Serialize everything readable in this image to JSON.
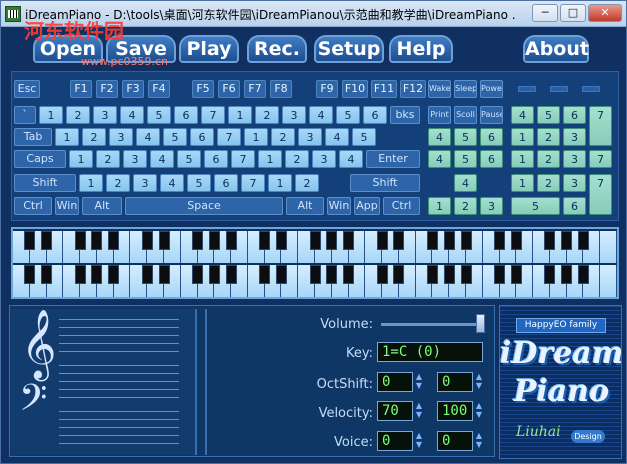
{
  "window": {
    "title": "iDreamPiano - D:\\tools\\桌面\\河东软件园\\iDreamPianou\\示范曲和教学曲\\iDreamPiano ...",
    "minimize": "─",
    "maximize": "□",
    "close": "✕"
  },
  "watermark": {
    "text": "河东软件园",
    "url": "www.pc0359.cn"
  },
  "menu": [
    {
      "label": "Open"
    },
    {
      "label": "Save"
    },
    {
      "label": "Play"
    },
    {
      "label": "Rec."
    },
    {
      "label": "Setup"
    },
    {
      "label": "Help"
    },
    {
      "label": "About"
    }
  ],
  "keyboard": {
    "fn_row": [
      "Esc",
      "F1",
      "F2",
      "F3",
      "F4",
      "F5",
      "F6",
      "F7",
      "F8",
      "F9",
      "F10",
      "F11",
      "F12",
      "Wake",
      "Sleep",
      "Power"
    ],
    "row1": [
      "`",
      "1",
      "2",
      "3",
      "4",
      "5",
      "6",
      "7",
      "1",
      "2",
      "3",
      "4",
      "5",
      "6",
      "bks"
    ],
    "row2": [
      "Tab",
      "1",
      "2",
      "3",
      "4",
      "5",
      "6",
      "7",
      "1",
      "2",
      "3",
      "4",
      "5"
    ],
    "row3": [
      "Caps",
      "1",
      "2",
      "3",
      "4",
      "5",
      "6",
      "7",
      "1",
      "2",
      "3",
      "4",
      "Enter"
    ],
    "row4": [
      "Shift",
      "1",
      "2",
      "3",
      "4",
      "5",
      "6",
      "7",
      "1",
      "2",
      "Shift"
    ],
    "row5": [
      "Ctrl",
      "Win",
      "Alt",
      "Space",
      "Alt",
      "Win",
      "App",
      "Ctrl"
    ],
    "nav1": [
      "Print",
      "Scoll",
      "Pause"
    ],
    "nav2": [
      "4",
      "5",
      "6"
    ],
    "nav3": [
      "4",
      "5",
      "6"
    ],
    "nav4": [
      "4"
    ],
    "nav5": [
      "1",
      "2",
      "3"
    ],
    "numpad": {
      "r1": [
        "4",
        "5",
        "6",
        "7"
      ],
      "r2": [
        "1",
        "2",
        "3"
      ],
      "r3": [
        "1",
        "2",
        "3"
      ],
      "r4": [
        "1",
        "2",
        "3",
        "7"
      ],
      "r5": [
        "5",
        "6"
      ]
    }
  },
  "controls": {
    "volume_label": "Volume:",
    "volume_level": 1.0,
    "key_label": "Key:",
    "key_value": "1=C  (0)",
    "octshift_label": "OctShift:",
    "octshift_left": "0",
    "octshift_right": "0",
    "velocity_label": "Velocity:",
    "velocity_left": "70",
    "velocity_right": "100",
    "voice_label": "Voice:",
    "voice_left": "0",
    "voice_right": "0"
  },
  "logo": {
    "tag": "HappyEO family",
    "line1": "iDream",
    "line2": "Piano",
    "signature": "Liuhai",
    "design": "Design"
  },
  "colors": {
    "background": "#0f3060",
    "key_light": "#a7d8f7",
    "key_green": "#a4e0cf",
    "lcd_text": "#7cff79"
  }
}
